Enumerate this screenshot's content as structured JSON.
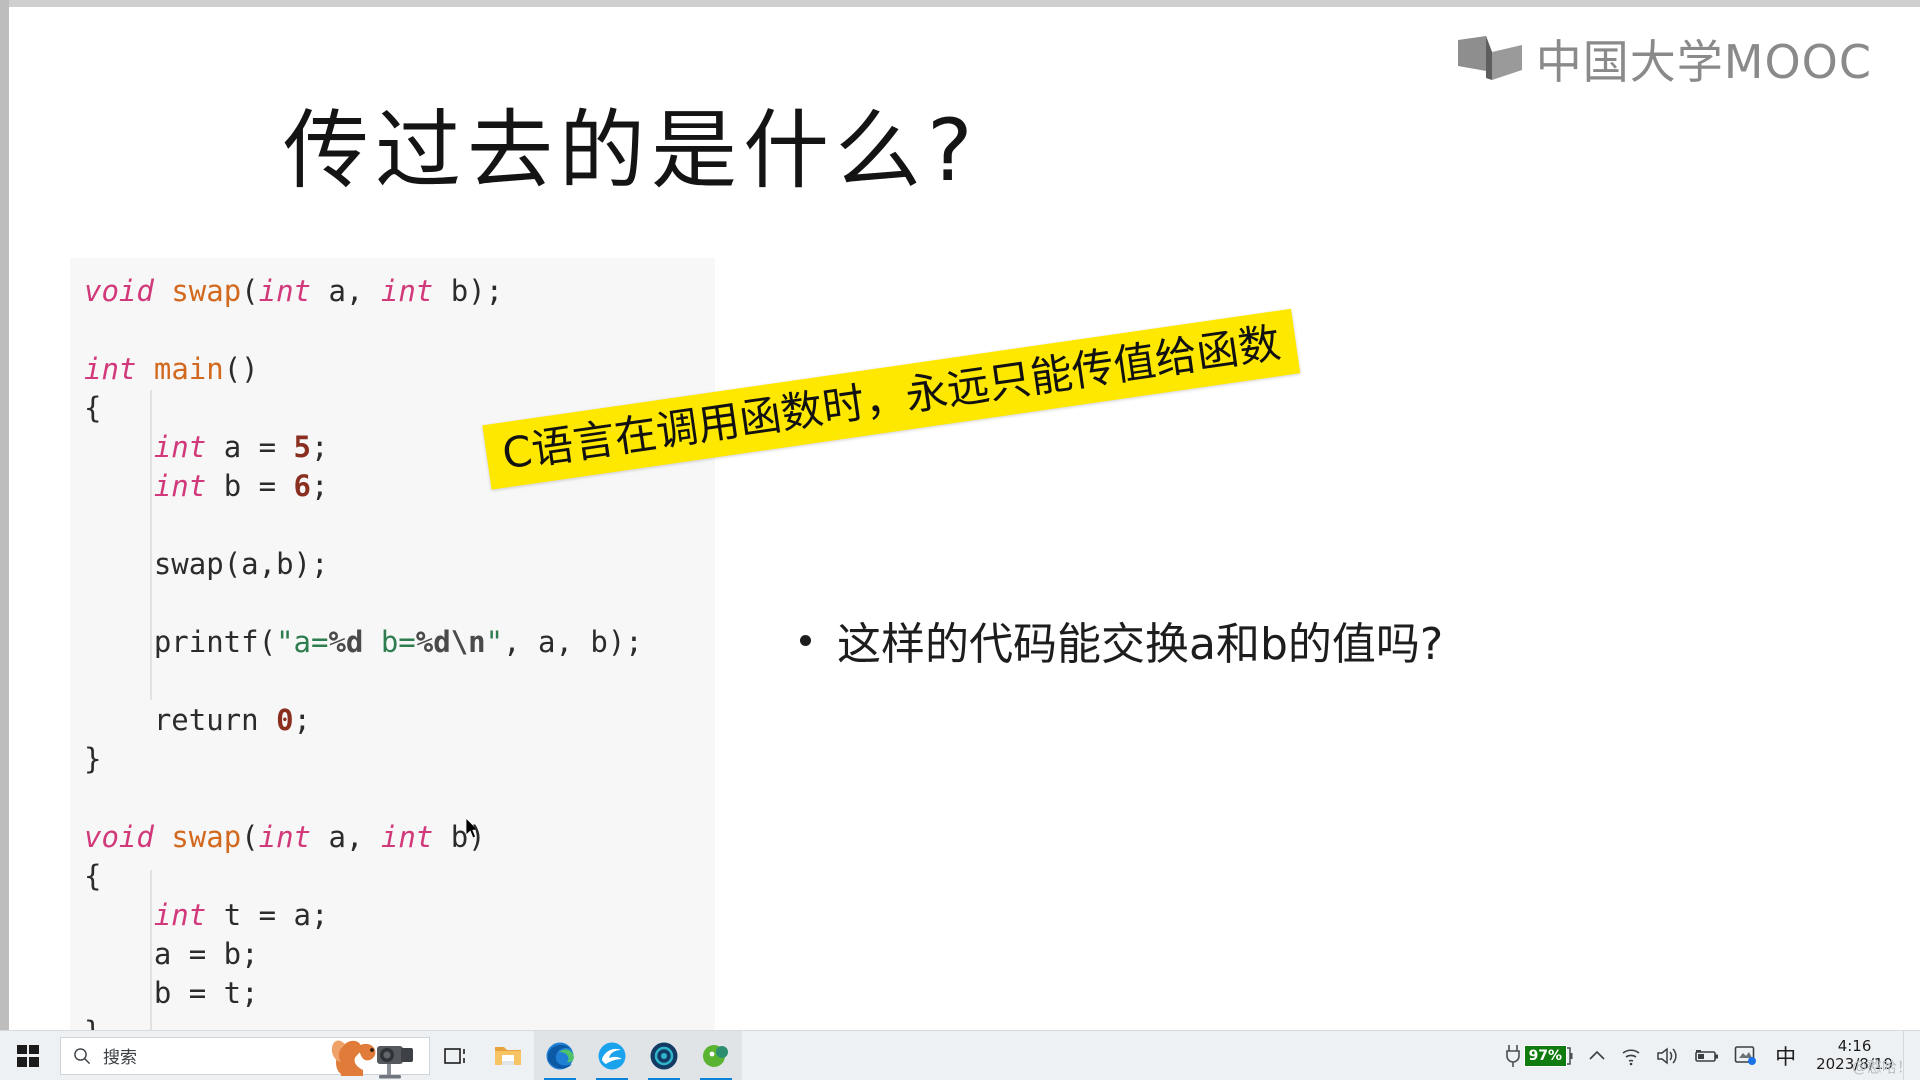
{
  "slide": {
    "title": "传过去的是什么?",
    "logo": {
      "text": "中国大学MOOC",
      "icon": "open-book-icon",
      "color": "#8a8a8a"
    },
    "code": {
      "language": "C",
      "background": "#f7f7f7",
      "colors": {
        "type_keyword": "#d1397a",
        "function_name": "#d2691e",
        "number": "#8a2f20",
        "string": "#2e7d4f",
        "plain": "#2b2b2b"
      },
      "lines": [
        "void swap(int a, int b);",
        "",
        "int main()",
        "{",
        "    int a = 5;",
        "    int b = 6;",
        "",
        "    swap(a,b);",
        "",
        "    printf(\"a=%d b=%d\\n\", a, b);",
        "",
        "    return 0;",
        "}",
        "",
        "void swap(int a, int b)",
        "{",
        "    int t = a;",
        "    a = b;",
        "    b = t;",
        "}"
      ]
    },
    "highlight_banner": {
      "text": "C语言在调用函数时，永远只能传值给函数",
      "background": "#ffe800",
      "text_color": "#111111",
      "rotation_deg": -8.2
    },
    "bullet": {
      "marker": "bullet-dot",
      "text": "这样的代码能交换a和b的值吗?"
    }
  },
  "taskbar": {
    "start_button": "start-button",
    "search": {
      "placeholder": "搜索",
      "icon": "search-icon",
      "decoration_icon": "squirrel-camera-icon"
    },
    "buttons": [
      {
        "name": "task-view-button",
        "icon": "task-view-icon",
        "label": "任务视图",
        "active": false
      },
      {
        "name": "file-explorer-button",
        "icon": "folder-icon",
        "label": "文件资源管理器",
        "active": false
      },
      {
        "name": "edge-button",
        "icon": "edge-icon",
        "label": "Microsoft Edge",
        "active": true
      },
      {
        "name": "browser-2-button",
        "icon": "e-browser-icon",
        "label": "浏览器",
        "active": true
      },
      {
        "name": "app-dark-button",
        "icon": "circle-dark-icon",
        "label": "应用",
        "active": true
      },
      {
        "name": "app-green-button",
        "icon": "green-app-icon",
        "label": "应用",
        "active": true
      }
    ],
    "tray": {
      "power_icon": "power-plug-icon",
      "battery_percent": "97%",
      "battery_color": "#107c10",
      "chevron_icon": "chevron-up-icon",
      "wifi_icon": "wifi-icon",
      "volume_icon": "speaker-icon",
      "battery_icon": "battery-icon",
      "screenshot_icon": "screenshot-tool-icon",
      "ime_label": "中",
      "time": "4:16",
      "date": "2023/8/19",
      "watermark": "@憨哈！"
    }
  }
}
